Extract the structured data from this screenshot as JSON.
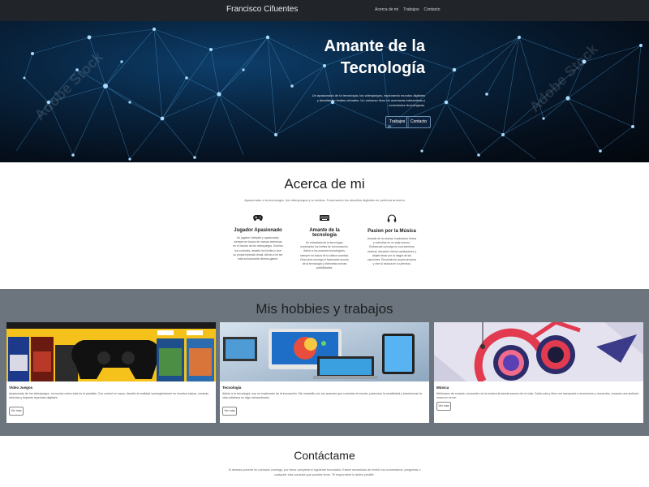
{
  "navbar": {
    "brand": "Francisco Cifuentes",
    "links": [
      "Acerca de mi",
      "Trabajos",
      "Contacto"
    ]
  },
  "hero": {
    "title_line1": "Amante de la",
    "title_line2": "Tecnología",
    "text": "Un apasionado de la tecnología, los videojuegos, explorando mundos digitales y desafiando límites virtuales. Un universo lleno de aventuras interactivas y conexiones tecnológicas.",
    "buttons": [
      "Trabajos",
      "Contacto"
    ],
    "watermark": "Adobe Stock"
  },
  "about": {
    "title": "Acerca de mi",
    "subtitle": "Apasionado a la tecnología, los videojuegos y la música. Fusionando los desafíos digitales en perfecta armonía",
    "features": [
      {
        "icon": "gamepad-icon",
        "title": "Jugador Apasionado",
        "text": "Un jugador intrépido y apasionado, siempre en busca de nuevas aventuras en el mundo de los videojuegos. Domina los controles, desafía los límites y vive su propia leyenda virtual. Afecto a mi ser más emocionante diversa gamer."
      },
      {
        "icon": "keyboard-icon",
        "title": "Amante de la tecnología",
        "text": "Un entusiasta de la tecnología, explorando los límites de la innovación. Adicto a los avances tecnológicos, siempre en busca de la última novedad. Descubre conmigo el fascinante mundo de la tecnología y obtendrás nuevas posibilidades."
      },
      {
        "icon": "headphones-icon",
        "title": "Pasion por la Música",
        "text": "Amante de la música, explorando ritmos y melodías en un viaje sonoro. Embárcate conmigo en una aventura musical, descubre ritmos cautivadores y déjate llevar por la magia de las canciones. Encuentra tu propia armonía y vive la música en su plenitud."
      }
    ]
  },
  "hobbies": {
    "title": "Mis hobbies y trabajos",
    "cards": [
      {
        "title": "Video Juegos",
        "text": "Apasionado de los videojuegos, mi mundo cobra vida en la pantalla. Con control en mano, desafío la realidad sumergiéndome en mundos épicos, creando historias y forjando leyendas digitales.",
        "button": "Ver más",
        "image": "video-games-image"
      },
      {
        "title": "Tecnología",
        "text": "Adicto a la tecnología, soy un explorador de la innovación. Me maravillo con los avances que conectan el mundo, potencian la creatividad y transforman la vida cotidiana en algo extraordinario.",
        "button": "Ver más",
        "image": "technology-image"
      },
      {
        "title": "Música",
        "text": "Melómano de corazón, encuentro en la música la banda sonora de mi vida. Cada nota y ritmo me transporta a emociones y recuerdos, creando una sinfonía única en mi ser.",
        "button": "Ver más",
        "image": "music-image"
      }
    ]
  },
  "contact": {
    "title": "Contáctame",
    "text": "Si deseas ponerte en contacto conmigo, por favor completa el siguiente formulario. Estaré encantado de recibir tus comentarios, preguntas o cualquier otra consulta que puedas tener. Te responderé lo antes posible."
  },
  "colors": {
    "navbar": "#212529",
    "hobbies_bg": "#6c757d",
    "hero_dark": "#05111f",
    "hero_node": "#9fd4ff"
  }
}
